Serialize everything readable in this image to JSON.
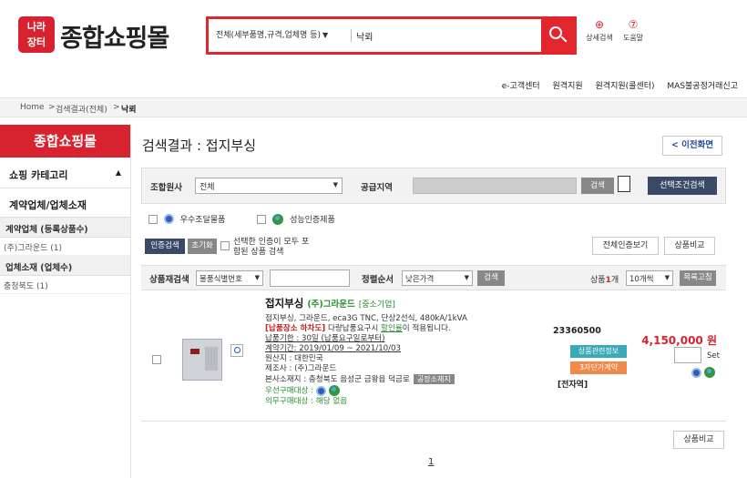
{
  "header": {
    "logo_badge": "나라\n장터",
    "logo_word": "종합쇼핑몰",
    "search_scope": "전체(세부품명,규격,업체명 등)",
    "search_value": "낙뢰",
    "detail_search": "상세검색",
    "help": "도움말"
  },
  "topnav": [
    "e-고객센터",
    "원격지원",
    "원격지원(콜센터)",
    "MAS불공정거래신고"
  ],
  "breadcrumb": {
    "home": "Home",
    "sep1": ">",
    "results": "검색결과(전체)",
    "sep2": ">",
    "query": "낙뢰"
  },
  "sidebar": {
    "title": "종합쇼핑몰",
    "category": "쇼핑 카테고리",
    "contract_label": "계약업체/업체소재",
    "group1": "계약업체 (등록상품수)",
    "group1_item": "(주)그라운드 (1)",
    "group2": "업체소재 (업체수)",
    "group2_item": "충청북도 (1)"
  },
  "main": {
    "title": "검색결과 : 접지부싱",
    "back": "< 이전화면"
  },
  "filter": {
    "org_label": "조합원사",
    "org_value": "전체",
    "region_label": "공급지역",
    "search_btn": "검색",
    "detail_btn": "선택조건검색"
  },
  "certs": {
    "excellent": "우수조달물품",
    "performance": "성능인증제품"
  },
  "buttons": {
    "cert_search": "인증검색",
    "reset": "초기화",
    "note": "선택한 인증이 모두 포함된 상품 검색",
    "view_all_certs": "전체인증보기",
    "compare": "상품비교"
  },
  "toolbar": {
    "research_label": "상품재검색",
    "research_field": "물품식별번호",
    "sort_label": "정렬순서",
    "sort_value": "낮은가격",
    "search_btn": "검색",
    "count_prefix": "상품",
    "count": "1",
    "count_suffix": "개",
    "per_page": "10개씩",
    "list_btn": "목록고침"
  },
  "product": {
    "name": "접지부싱",
    "company": "(주)그라운드",
    "size": "[중소기업]",
    "spec": "접지부싱, 그라운드, eca3G TNC, 단상2선식, 480kA/1kVA",
    "notice_red": "[납품장소 하차도]",
    "notice_text": "다량납품요구시",
    "notice_discount": "할인율",
    "notice_end": "이 적용됩니다.",
    "delivery": "납품기한 : 30일 (납품요구일로부터)",
    "contract_period": "계약기간: 2019/01/09 ~ 2021/10/03",
    "origin": "원산지 : 대한민국",
    "maker": "제조사 : (주)그라운드",
    "address": "본사소재지 : 충청북도 음성군 금왕읍 덕금로",
    "address_tag": "공장소재지",
    "priority": "우선구매대상 :",
    "mandatory": "의무구매대상 : 해당 없음",
    "code": "23360500",
    "info_chip": "상품관련정보",
    "contract_chip": "3자단가계약",
    "contract_type": "[전자역]",
    "price": "4,150,000 원",
    "set": "Set"
  },
  "pager": "1"
}
